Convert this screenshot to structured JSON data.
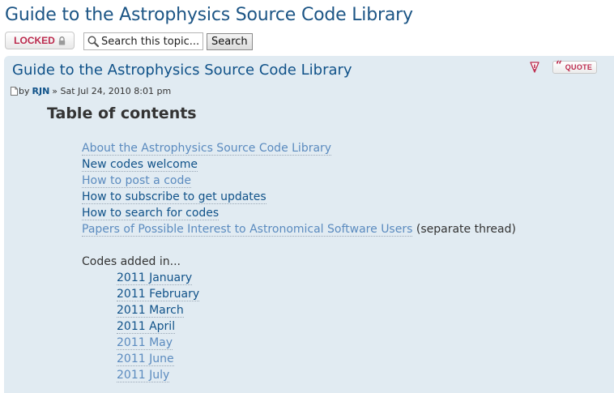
{
  "page": {
    "title": "Guide to the Astrophysics Source Code Library"
  },
  "toolbar": {
    "locked_label": "LOCKED",
    "search_placeholder": "Search this topic...",
    "search_button": "Search"
  },
  "post": {
    "title": "Guide to the Astrophysics Source Code Library",
    "quote_label": "QUOTE",
    "meta_prefix": "by",
    "author": "RJN",
    "meta_suffix": "» Sat Jul 24, 2010 8:01 pm",
    "toc_heading": "Table of contents",
    "toc_links": [
      {
        "label": "About the Astrophysics Source Code Library",
        "state": "visited"
      },
      {
        "label": "New codes welcome",
        "state": "new"
      },
      {
        "label": "How to post a code",
        "state": "visited"
      },
      {
        "label": "How to subscribe to get updates",
        "state": "new"
      },
      {
        "label": "How to search for codes",
        "state": "new"
      },
      {
        "label": "Papers of Possible Interest to Astronomical Software Users",
        "state": "visited",
        "note": "(separate thread)"
      }
    ],
    "codes_added_label": "Codes added in...",
    "months": [
      {
        "label": "2011 January",
        "state": "new"
      },
      {
        "label": "2011 February",
        "state": "new"
      },
      {
        "label": "2011 March",
        "state": "new"
      },
      {
        "label": "2011 April",
        "state": "new"
      },
      {
        "label": "2011 May",
        "state": "visited"
      },
      {
        "label": "2011 June",
        "state": "visited"
      },
      {
        "label": "2011 July",
        "state": "visited"
      }
    ]
  },
  "colors": {
    "title": "#1c5585",
    "post_background": "#e1ebf2",
    "link_new": "#105289",
    "link_visited": "#5b8bbf",
    "locked_text": "#bc2a4d"
  },
  "icons": {
    "locked": "lock-icon",
    "search": "magnifier-icon",
    "report": "report-warning-icon",
    "quote": "quote-icon",
    "post": "document-icon"
  }
}
